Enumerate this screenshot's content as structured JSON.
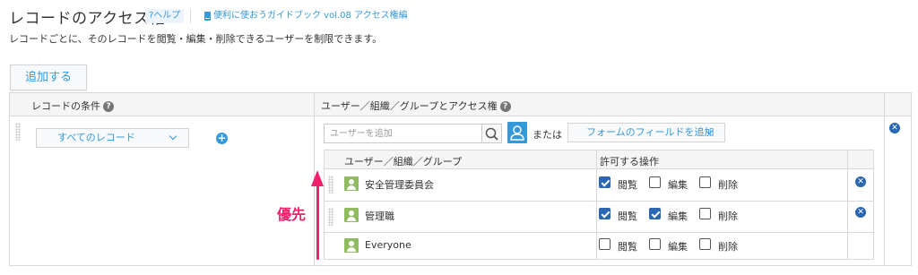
{
  "header": {
    "title": "レコードのアクセス権",
    "help_label": "?ヘルプ",
    "guide_label": "便利に使おうガイドブック vol.08 アクセス権編",
    "description": "レコードごとに、そのレコードを閲覧・編集・削除できるユーザーを制限できます。"
  },
  "toolbar": {
    "add_label": "追加する"
  },
  "table": {
    "col_condition": "レコードの条件",
    "col_access": "ユーザー／組織／グループとアクセス権",
    "condition_select": "すべてのレコード",
    "user_search_placeholder": "ユーザーを追加",
    "or_label": "または",
    "field_button": "フォームのフィールドを追加"
  },
  "inner_table": {
    "col_entity": "ユーザー／組織／グループ",
    "col_ops": "許可する操作",
    "ops": [
      "閲覧",
      "編集",
      "削除"
    ],
    "rows": [
      {
        "name": "安全管理委員会",
        "view": true,
        "edit": false,
        "delete": false,
        "removable": true
      },
      {
        "name": "管理職",
        "view": true,
        "edit": true,
        "delete": false,
        "removable": true
      },
      {
        "name": "Everyone",
        "view": false,
        "edit": false,
        "delete": false,
        "removable": false
      }
    ]
  },
  "annotation": {
    "label": "優先",
    "color": "#f0216c"
  },
  "colors": {
    "accent": "#3498db",
    "checkbox": "#2b67b1",
    "group_icon": "#8ebc5e"
  }
}
